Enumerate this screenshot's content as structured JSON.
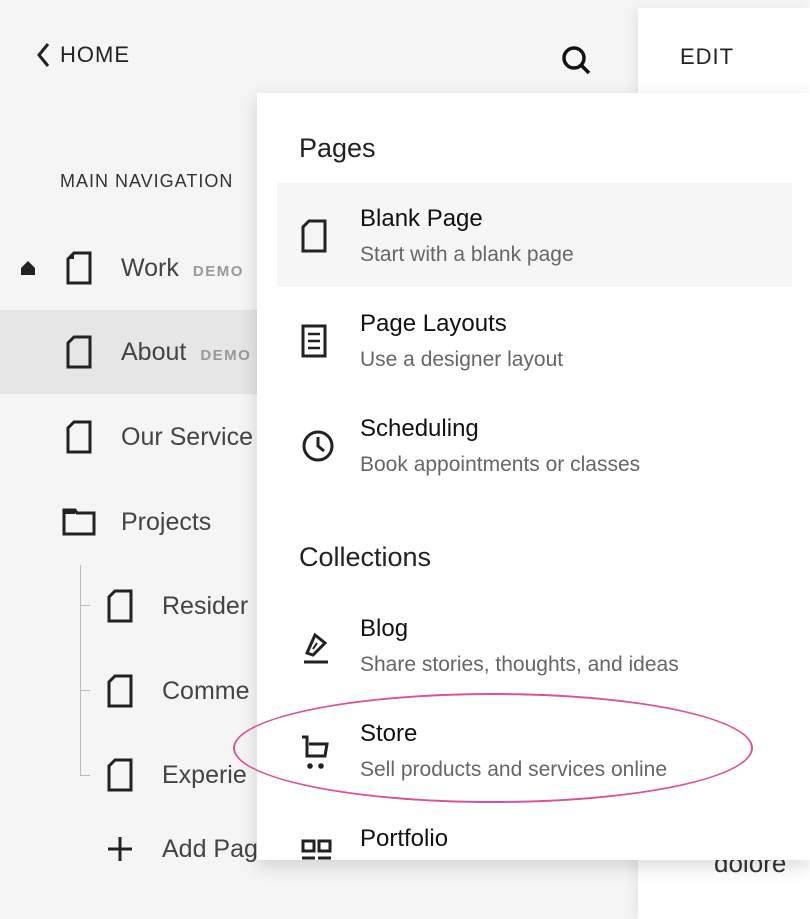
{
  "header": {
    "back_label": "HOME",
    "edit_label": "EDIT"
  },
  "preview_text": "dolore",
  "navigation": {
    "section_label": "MAIN NAVIGATION",
    "items": [
      {
        "label": "Work",
        "badge": "DEMO",
        "homepage": true,
        "icon": "page-icon"
      },
      {
        "label": "About",
        "badge": "DEMO",
        "selected": true,
        "icon": "page-icon"
      },
      {
        "label": "Our Service",
        "icon": "page-icon"
      },
      {
        "label": "Projects",
        "icon": "folder-icon"
      }
    ],
    "sub_items": [
      {
        "label": "Resider",
        "icon": "page-icon"
      },
      {
        "label": "Comme",
        "icon": "page-icon"
      },
      {
        "label": "Experie",
        "icon": "page-icon"
      }
    ],
    "add_label": "Add Pag"
  },
  "menu": {
    "pages_heading": "Pages",
    "pages": [
      {
        "title": "Blank Page",
        "desc": "Start with a blank page",
        "icon": "page-icon"
      },
      {
        "title": "Page Layouts",
        "desc": "Use a designer layout",
        "icon": "layout-icon"
      },
      {
        "title": "Scheduling",
        "desc": "Book appointments or classes",
        "icon": "clock-icon"
      }
    ],
    "collections_heading": "Collections",
    "collections": [
      {
        "title": "Blog",
        "desc": "Share stories, thoughts, and ideas",
        "icon": "pen-icon"
      },
      {
        "title": "Store",
        "desc": "Sell products and services online",
        "icon": "cart-icon"
      },
      {
        "title": "Portfolio",
        "icon": "grid-icon"
      }
    ]
  },
  "colors": {
    "highlight_ellipse": "#d9539a"
  }
}
